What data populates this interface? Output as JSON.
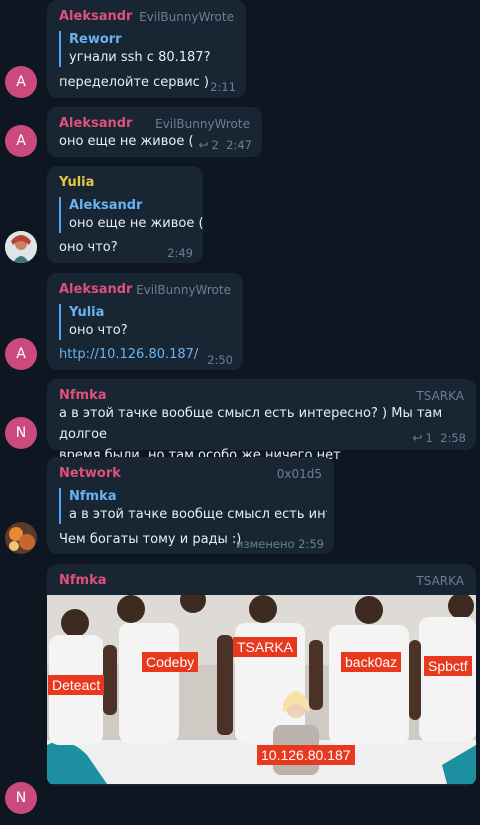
{
  "colors": {
    "background": "#0e1621",
    "bubble": "#182533",
    "name_pink": "#e1507a",
    "name_yellow": "#e8c545",
    "quote_blue": "#6ab2f2",
    "avatar_pink": "#cb4a7d"
  },
  "messages": [
    {
      "author": "Aleksandr",
      "tag": "EvilBunnyWrote",
      "quote_author": "Reworr",
      "quote_text": "угнали ssh с 80.187?",
      "text": "переделойте сервис )",
      "time": "2:11",
      "avatar_letter": "A"
    },
    {
      "author": "Aleksandr",
      "tag": "EvilBunnyWrote",
      "text": "оно еще не живое (",
      "replies": "2",
      "time": "2:47",
      "avatar_letter": "A"
    },
    {
      "author": "Yulia",
      "quote_author": "Aleksandr",
      "quote_text": "оно еще не живое (",
      "text": "оно что?",
      "time": "2:49",
      "avatar_icon": "yulia-avatar-icon"
    },
    {
      "author": "Aleksandr",
      "tag": "EvilBunnyWrote",
      "quote_author": "Yulia",
      "quote_text": "оно что?",
      "text": "http://10.126.80.187/",
      "time": "2:50",
      "avatar_letter": "A"
    },
    {
      "author": "Nfmka",
      "tag": "TSARKA",
      "text_line1": "а в этой тачке вообще смысл есть интересно? ) Мы там долгое",
      "text_line2": "время были, но там особо же ничего нет",
      "replies": "1",
      "time": "2:58",
      "avatar_letter": "N"
    },
    {
      "author": "Network",
      "tag": "0x01d5",
      "quote_author": "Nfmka",
      "quote_text": "а в этой тачке вообще смысл есть инте...",
      "text": "Чем богаты тому и рады :)",
      "time": "изменено 2:59",
      "avatar_icon": "network-avatar-icon"
    },
    {
      "author": "Nfmka",
      "tag": "TSARKA",
      "avatar_letter": "N",
      "photo_labels": [
        "Deteact",
        "Codeby",
        "TSARKA",
        "back0az",
        "Spbctf",
        "10.126.80.187"
      ]
    }
  ]
}
